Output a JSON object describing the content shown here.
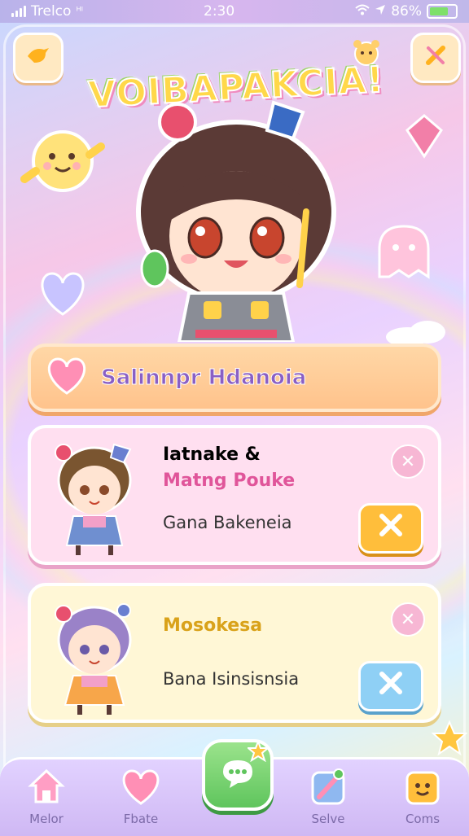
{
  "status_bar": {
    "carrier": "Trelco",
    "network": "ᴴᴵ",
    "time": "2:30",
    "battery": "86%"
  },
  "header": {
    "title": "VOIBAPAKCIA!"
  },
  "banner": {
    "label": "Salinnpr Hdanoia"
  },
  "cards": [
    {
      "title_line1": "Iatnake &",
      "title_line2": "Matng Pouke",
      "subtitle": "Gana Bakeneia",
      "title_color_1": "#8a5fc4",
      "title_color_2": "#e0559a"
    },
    {
      "title_line1": "Mosokesa",
      "subtitle": "Bana Isinsisnsia",
      "title_color_1": "#d9a21a"
    }
  ],
  "nav": {
    "items": [
      {
        "label": "Melor",
        "icon": "house-icon"
      },
      {
        "label": "Fbate",
        "icon": "heart-icon"
      },
      {
        "label": "Selve",
        "icon": "edit-icon"
      },
      {
        "label": "Coms",
        "icon": "smiley-icon"
      }
    ],
    "center_icon": "chat-icon"
  },
  "colors": {
    "accent_pink": "#f08cc0",
    "accent_green": "#5fc55d",
    "accent_orange": "#ffbe3b",
    "accent_blue": "#8fd0f5"
  }
}
